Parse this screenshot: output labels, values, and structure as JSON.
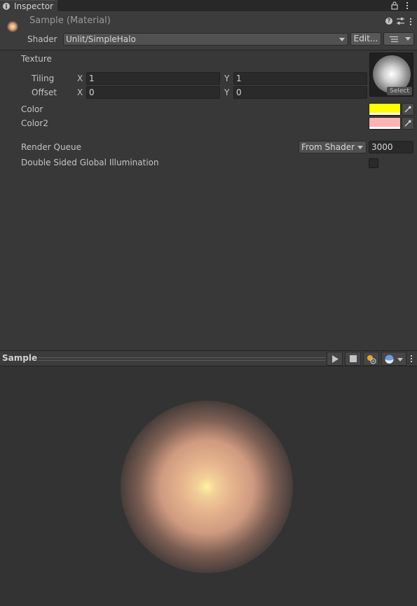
{
  "tab": {
    "label": "Inspector"
  },
  "header": {
    "title": "Sample (Material)",
    "shader_label": "Shader",
    "shader_value": "Unlit/SimpleHalo",
    "edit_label": "Edit..."
  },
  "properties": {
    "texture_label": "Texture",
    "tiling_label": "Tiling",
    "offset_label": "Offset",
    "x_label": "X",
    "y_label": "Y",
    "tiling_x": "1",
    "tiling_y": "1",
    "offset_x": "0",
    "offset_y": "0",
    "select_label": "Select",
    "color_label": "Color",
    "color2_label": "Color2",
    "color_value": "#ffff00",
    "color2_value": "#ffb3b3",
    "render_queue_label": "Render Queue",
    "render_queue_mode": "From Shader",
    "render_queue_value": "3000",
    "dsgi_label": "Double Sided Global Illumination",
    "dsgi_checked": false
  },
  "preview": {
    "title": "Sample"
  },
  "icons": [
    "info-icon",
    "lock-icon",
    "kebab-menu-icon",
    "help-icon",
    "preset-icon",
    "list-icon",
    "eyedropper-icon",
    "play-icon",
    "stop-icon",
    "light-toggle-icon",
    "sphere-mesh-icon"
  ]
}
